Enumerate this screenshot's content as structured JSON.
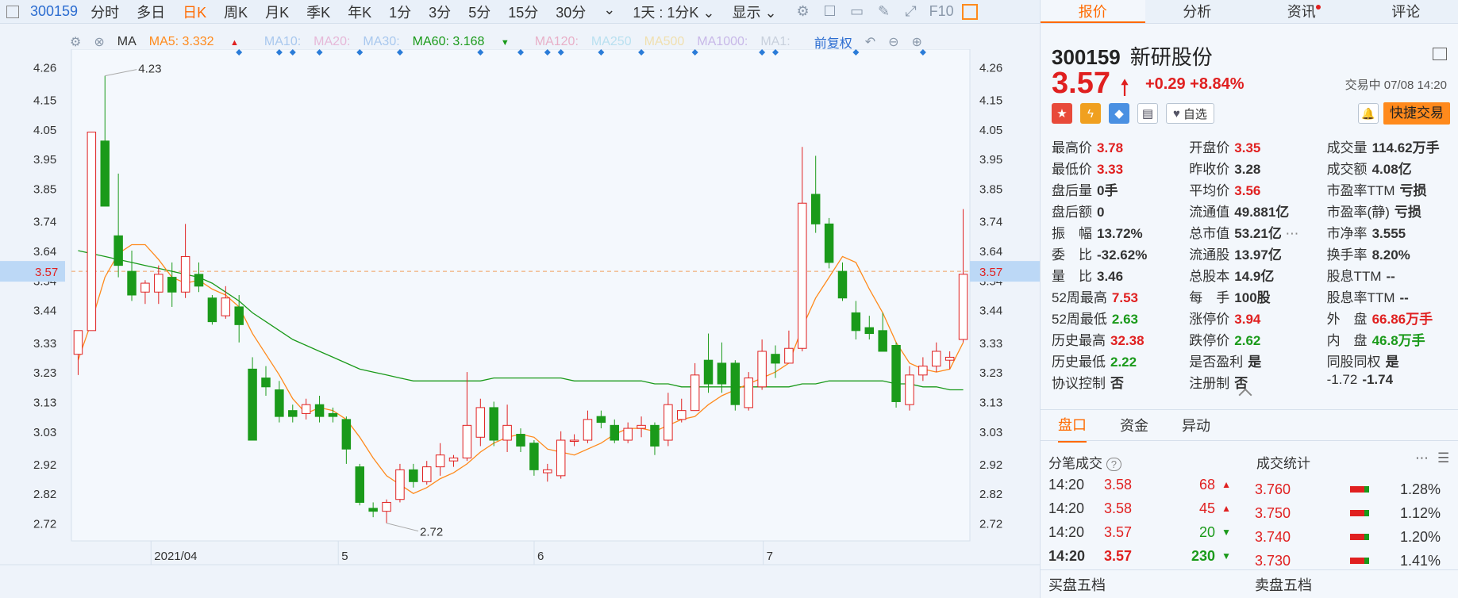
{
  "toolbar": {
    "code": "300159",
    "periods": [
      "分时",
      "多日",
      "日K",
      "周K",
      "月K",
      "季K",
      "年K",
      "1分",
      "3分",
      "5分",
      "15分",
      "30分"
    ],
    "active_period": "日K",
    "range_label": "1天 : 1分K",
    "display_label": "显示",
    "f10_label": "F10"
  },
  "ma_bar": {
    "ma_label": "MA",
    "ma5": "MA5: 3.332",
    "ma10": "MA10:",
    "ma20": "MA20:",
    "ma30": "MA30:",
    "ma60": "MA60: 3.168",
    "ma120": "MA120:",
    "ma250": "MA250",
    "ma500": "MA500",
    "ma1000": "MA1000:",
    "ma1": "MA1:",
    "adjust": "前复权",
    "colors": {
      "ma5": "#ff8a1c",
      "ma10": "#a9c8ee",
      "ma20": "#e6b8d8",
      "ma30": "#a9c8ee",
      "ma60": "#1a9a1a",
      "ma120": "#e8b0c8",
      "ma250": "#b9e0f0",
      "ma500": "#f0e0b0",
      "ma1000": "#c8b8e8",
      "ma1": "#c8d0dc"
    }
  },
  "chart_data": {
    "type": "candlestick",
    "y_ticks": [
      "4.26",
      "4.15",
      "4.05",
      "3.95",
      "3.85",
      "3.74",
      "3.64",
      "3.54",
      "3.44",
      "3.33",
      "3.23",
      "3.13",
      "3.03",
      "2.92",
      "2.82",
      "2.72"
    ],
    "x_labels": [
      "2021/04",
      "5",
      "6",
      "7"
    ],
    "current_price_label": "3.57",
    "high_annotation": "4.23",
    "low_annotation": "2.72",
    "ylim": [
      2.66,
      4.32
    ],
    "candles": [
      [
        3.29,
        3.37,
        3.22,
        3.37
      ],
      [
        3.37,
        4.04,
        3.37,
        4.04
      ],
      [
        4.01,
        3.79,
        4.23,
        3.79
      ],
      [
        3.69,
        3.59,
        3.9,
        3.55
      ],
      [
        3.57,
        3.49,
        3.64,
        3.47
      ],
      [
        3.5,
        3.53,
        3.54,
        3.46
      ],
      [
        3.5,
        3.56,
        3.59,
        3.46
      ],
      [
        3.55,
        3.5,
        3.6,
        3.45
      ],
      [
        3.5,
        3.62,
        3.73,
        3.48
      ],
      [
        3.56,
        3.52,
        3.6,
        3.5
      ],
      [
        3.48,
        3.4,
        3.49,
        3.39
      ],
      [
        3.42,
        3.48,
        3.52,
        3.41
      ],
      [
        3.45,
        3.39,
        3.49,
        3.33
      ],
      [
        3.24,
        3.0,
        3.28,
        3.0
      ],
      [
        3.21,
        3.18,
        3.25,
        3.15
      ],
      [
        3.17,
        3.08,
        3.2,
        3.06
      ],
      [
        3.1,
        3.08,
        3.12,
        3.06
      ],
      [
        3.09,
        3.12,
        3.14,
        3.07
      ],
      [
        3.12,
        3.08,
        3.15,
        3.06
      ],
      [
        3.09,
        3.08,
        3.11,
        3.06
      ],
      [
        3.07,
        2.97,
        3.08,
        2.92
      ],
      [
        2.91,
        2.79,
        2.92,
        2.78
      ],
      [
        2.77,
        2.76,
        2.79,
        2.74
      ],
      [
        2.76,
        2.79,
        2.8,
        2.72
      ],
      [
        2.8,
        2.9,
        2.92,
        2.79
      ],
      [
        2.9,
        2.86,
        2.92,
        2.84
      ],
      [
        2.86,
        2.91,
        2.93,
        2.85
      ],
      [
        2.91,
        2.95,
        2.99,
        2.88
      ],
      [
        2.93,
        2.94,
        2.95,
        2.91
      ],
      [
        2.94,
        3.05,
        3.23,
        2.93
      ],
      [
        3.01,
        3.11,
        3.14,
        2.98
      ],
      [
        3.11,
        3.0,
        3.13,
        2.98
      ],
      [
        3.0,
        3.05,
        3.12,
        2.96
      ],
      [
        3.02,
        2.98,
        3.04,
        2.96
      ],
      [
        2.99,
        2.9,
        3.0,
        2.88
      ],
      [
        2.89,
        2.9,
        2.92,
        2.86
      ],
      [
        2.88,
        3.0,
        3.03,
        2.87
      ],
      [
        3.0,
        3.0,
        3.02,
        2.98
      ],
      [
        3.0,
        3.07,
        3.1,
        2.99
      ],
      [
        3.08,
        3.06,
        3.1,
        3.04
      ],
      [
        3.05,
        3.0,
        3.07,
        2.99
      ],
      [
        3.0,
        3.04,
        3.06,
        2.99
      ],
      [
        3.04,
        3.05,
        3.08,
        3.01
      ],
      [
        3.05,
        2.98,
        3.06,
        2.95
      ],
      [
        3.0,
        3.12,
        3.16,
        2.98
      ],
      [
        3.07,
        3.1,
        3.14,
        3.06
      ],
      [
        3.1,
        3.22,
        3.26,
        3.1
      ],
      [
        3.27,
        3.19,
        3.36,
        3.16
      ],
      [
        3.26,
        3.19,
        3.33,
        3.16
      ],
      [
        3.26,
        3.12,
        3.27,
        3.1
      ],
      [
        3.11,
        3.21,
        3.23,
        3.1
      ],
      [
        3.18,
        3.3,
        3.34,
        3.17
      ],
      [
        3.29,
        3.26,
        3.32,
        3.21
      ],
      [
        3.26,
        3.31,
        3.37,
        3.27
      ],
      [
        3.31,
        3.8,
        3.99,
        3.3
      ],
      [
        3.83,
        3.73,
        3.96,
        3.7
      ],
      [
        3.73,
        3.6,
        3.75,
        3.58
      ],
      [
        3.57,
        3.48,
        3.6,
        3.47
      ],
      [
        3.43,
        3.37,
        3.47,
        3.34
      ],
      [
        3.38,
        3.36,
        3.42,
        3.34
      ],
      [
        3.37,
        3.3,
        3.43,
        3.3
      ],
      [
        3.32,
        3.13,
        3.33,
        3.11
      ],
      [
        3.12,
        3.22,
        3.25,
        3.1
      ],
      [
        3.22,
        3.25,
        3.28,
        3.2
      ],
      [
        3.25,
        3.3,
        3.33,
        3.23
      ],
      [
        3.27,
        3.28,
        3.3,
        3.24
      ],
      [
        3.34,
        3.56,
        3.78,
        3.33
      ]
    ],
    "ma5": [
      3.27,
      3.4,
      3.55,
      3.63,
      3.66,
      3.66,
      3.61,
      3.55,
      3.53,
      3.54,
      3.51,
      3.49,
      3.45,
      3.36,
      3.29,
      3.22,
      3.14,
      3.09,
      3.11,
      3.1,
      3.07,
      3.01,
      2.94,
      2.88,
      2.85,
      2.82,
      2.84,
      2.87,
      2.89,
      2.92,
      2.96,
      2.99,
      3.01,
      3.02,
      3.01,
      2.97,
      2.96,
      2.95,
      2.97,
      2.99,
      3.02,
      3.04,
      3.04,
      3.03,
      3.05,
      3.07,
      3.08,
      3.12,
      3.15,
      3.17,
      3.19,
      3.21,
      3.23,
      3.26,
      3.38,
      3.48,
      3.55,
      3.62,
      3.6,
      3.51,
      3.43,
      3.33,
      3.26,
      3.24,
      3.23,
      3.24,
      3.33
    ],
    "ma60": [
      3.64,
      3.63,
      3.62,
      3.61,
      3.6,
      3.59,
      3.58,
      3.57,
      3.56,
      3.55,
      3.53,
      3.5,
      3.47,
      3.43,
      3.4,
      3.37,
      3.34,
      3.32,
      3.3,
      3.28,
      3.26,
      3.24,
      3.23,
      3.22,
      3.21,
      3.2,
      3.2,
      3.2,
      3.2,
      3.2,
      3.2,
      3.21,
      3.21,
      3.21,
      3.21,
      3.21,
      3.21,
      3.2,
      3.2,
      3.2,
      3.2,
      3.2,
      3.2,
      3.19,
      3.19,
      3.18,
      3.18,
      3.18,
      3.18,
      3.18,
      3.18,
      3.18,
      3.18,
      3.18,
      3.19,
      3.19,
      3.2,
      3.2,
      3.2,
      3.2,
      3.2,
      3.19,
      3.19,
      3.18,
      3.18,
      3.17,
      3.17
    ],
    "event_marker_indexes": [
      12,
      15,
      16,
      18,
      21,
      24,
      30,
      33,
      35,
      36,
      39,
      42,
      46,
      51,
      52,
      58,
      63
    ]
  },
  "quote": {
    "code": "300159",
    "name": "新研股份",
    "price": "3.57",
    "change": "+0.29",
    "change_pct": "+8.84%",
    "trade_status": "交易中 07/08 14:20",
    "watch_label": "自选",
    "quick_trade_label": "快捷交易",
    "stats": [
      [
        {
          "label": "最高价",
          "value": "3.78",
          "color": "red"
        },
        {
          "label": "开盘价",
          "value": "3.35",
          "color": "red"
        },
        {
          "label": "成交量",
          "value": "114.62万手",
          "color": "dark"
        }
      ],
      [
        {
          "label": "最低价",
          "value": "3.33",
          "color": "red"
        },
        {
          "label": "昨收价",
          "value": "3.28",
          "color": "dark"
        },
        {
          "label": "成交额",
          "value": "4.08亿",
          "color": "dark"
        }
      ],
      [
        {
          "label": "盘后量",
          "value": "0手",
          "color": "dark"
        },
        {
          "label": "平均价",
          "value": "3.56",
          "color": "red"
        },
        {
          "label": "市盈率TTM",
          "value": "亏损",
          "color": "dark"
        }
      ],
      [
        {
          "label": "盘后额",
          "value": "0",
          "color": "dark"
        },
        {
          "label": "流通值",
          "value": "49.881亿",
          "color": "dark"
        },
        {
          "label": "市盈率(静)",
          "value": "亏损",
          "color": "dark"
        }
      ],
      [
        {
          "label": "振　幅",
          "value": "13.72%",
          "color": "dark"
        },
        {
          "label": "总市值",
          "value": "53.21亿",
          "color": "dark"
        },
        {
          "label": "市净率",
          "value": "3.555",
          "color": "dark"
        }
      ],
      [
        {
          "label": "委　比",
          "value": "-32.62%",
          "color": "dark"
        },
        {
          "label": "流通股",
          "value": "13.97亿",
          "color": "dark"
        },
        {
          "label": "换手率",
          "value": "8.20%",
          "color": "dark"
        }
      ],
      [
        {
          "label": "量　比",
          "value": "3.46",
          "color": "dark"
        },
        {
          "label": "总股本",
          "value": "14.9亿",
          "color": "dark"
        },
        {
          "label": "股息TTM",
          "value": "--",
          "color": "dark"
        }
      ],
      [
        {
          "label": "52周最高",
          "value": "7.53",
          "color": "red"
        },
        {
          "label": "每　手",
          "value": "100股",
          "color": "dark"
        },
        {
          "label": "股息率TTM",
          "value": "--",
          "color": "dark"
        }
      ],
      [
        {
          "label": "52周最低",
          "value": "2.63",
          "color": "green"
        },
        {
          "label": "涨停价",
          "value": "3.94",
          "color": "red"
        },
        {
          "label": "外　盘",
          "value": "66.86万手",
          "color": "red"
        }
      ],
      [
        {
          "label": "历史最高",
          "value": "32.38",
          "color": "red"
        },
        {
          "label": "跌停价",
          "value": "2.62",
          "color": "green"
        },
        {
          "label": "内　盘",
          "value": "46.8万手",
          "color": "green"
        }
      ],
      [
        {
          "label": "历史最低",
          "value": "2.22",
          "color": "green"
        },
        {
          "label": "是否盈利",
          "value": "是",
          "color": "dark"
        },
        {
          "label": "同股同权",
          "value": "是",
          "color": "dark"
        }
      ],
      [
        {
          "label": "协议控制",
          "value": "否",
          "color": "dark"
        },
        {
          "label": "注册制",
          "value": "否",
          "color": "dark"
        },
        {
          "label": "-1.72",
          "value": "-1.74",
          "color": "dark"
        }
      ]
    ]
  },
  "panel_tabs": [
    "报价",
    "分析",
    "资讯",
    "评论"
  ],
  "sub_tabs": [
    "盘口",
    "资金",
    "异动"
  ],
  "ticks_title": "分笔成交",
  "ticks": [
    {
      "time": "14:20",
      "price": "3.58",
      "vol": "68",
      "dir": "up"
    },
    {
      "time": "14:20",
      "price": "3.58",
      "vol": "45",
      "dir": "up"
    },
    {
      "time": "14:20",
      "price": "3.57",
      "vol": "20",
      "dir": "down"
    },
    {
      "time": "14:20",
      "price": "3.57",
      "vol": "230",
      "dir": "down"
    }
  ],
  "stats_title": "成交统计",
  "trade_stats": [
    {
      "price": "3.760",
      "pct": "1.28%"
    },
    {
      "price": "3.750",
      "pct": "1.12%"
    },
    {
      "price": "3.740",
      "pct": "1.20%"
    },
    {
      "price": "3.730",
      "pct": "1.41%"
    }
  ],
  "buy_five": "买盘五档",
  "sell_five": "卖盘五档"
}
